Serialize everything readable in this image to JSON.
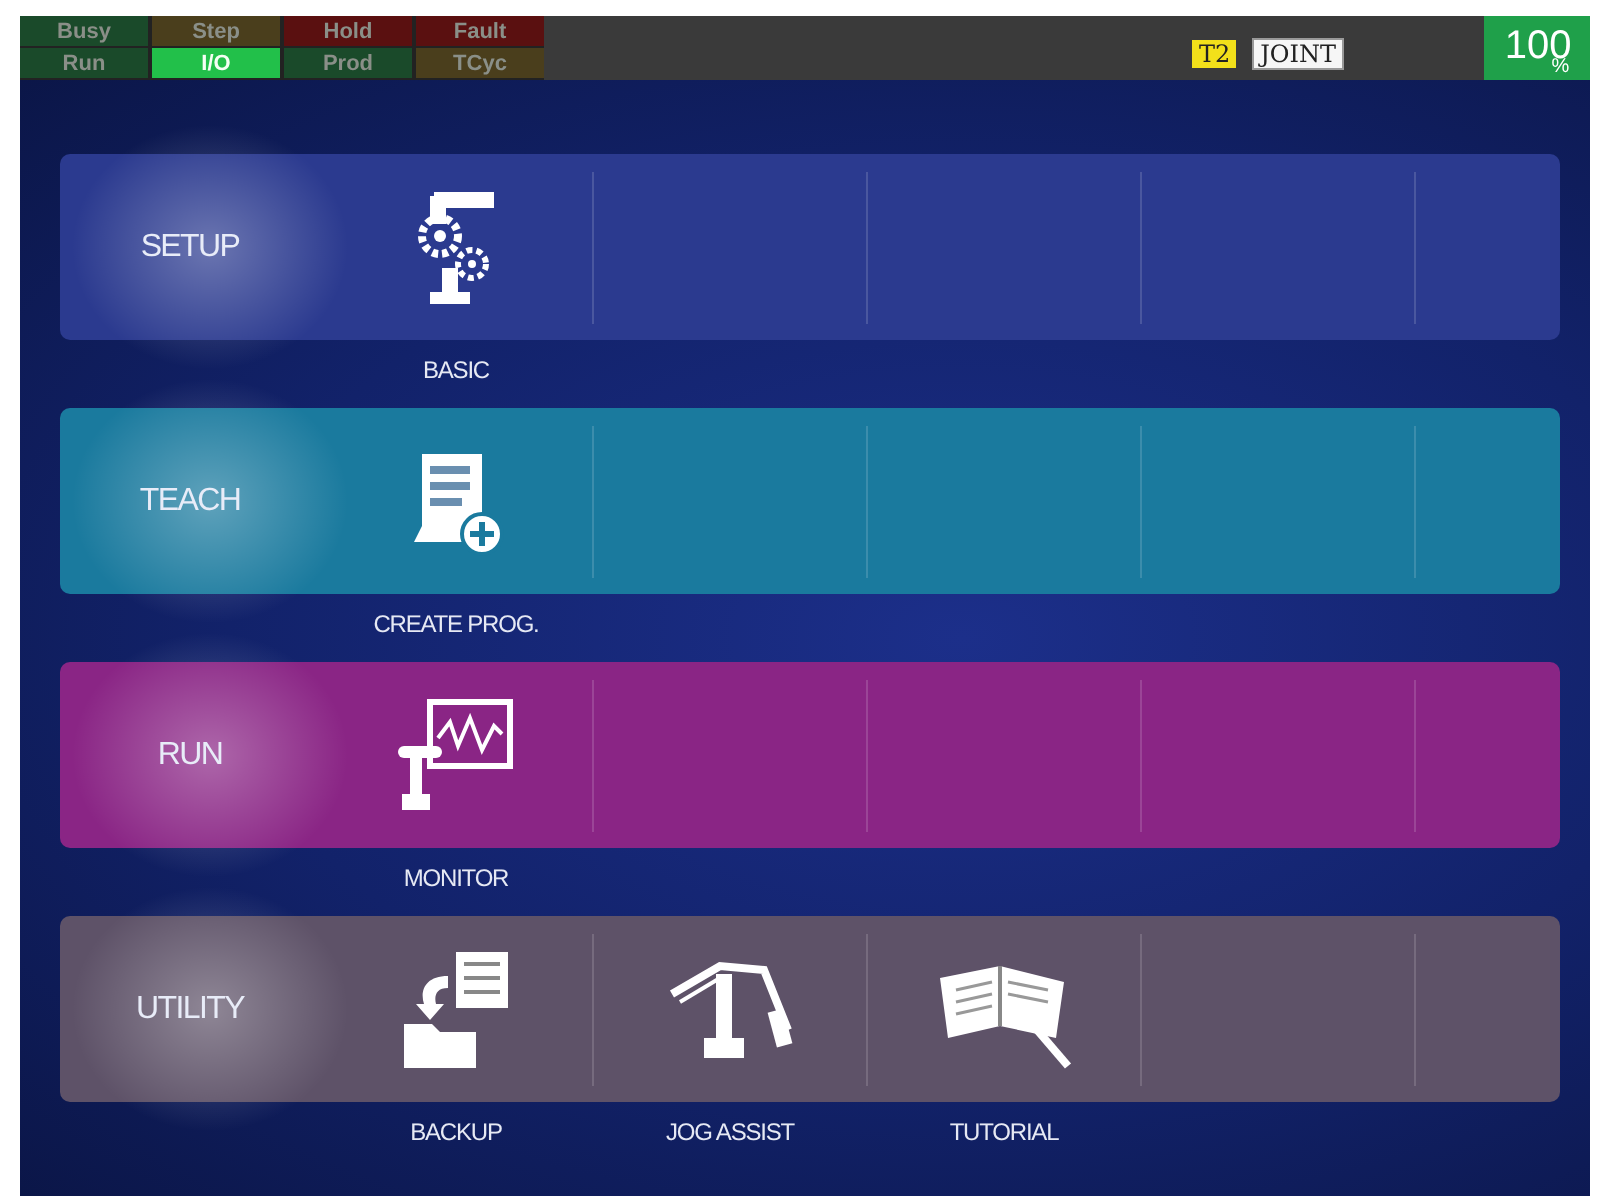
{
  "status_lamps": [
    {
      "label": "Busy",
      "on": false,
      "color": "#1a4a2a"
    },
    {
      "label": "Step",
      "on": false,
      "color": "#4a3e1c"
    },
    {
      "label": "Hold",
      "on": false,
      "color": "#5a1010"
    },
    {
      "label": "Fault",
      "on": false,
      "color": "#5a1010"
    },
    {
      "label": "Run",
      "on": false,
      "color": "#1a4a2a"
    },
    {
      "label": "I/O",
      "on": true,
      "color": "#22c04a"
    },
    {
      "label": "Prod",
      "on": false,
      "color": "#1a4a2a"
    },
    {
      "label": "TCyc",
      "on": false,
      "color": "#4a3e1c"
    }
  ],
  "mode_badges": [
    {
      "label": "T2",
      "kind": "tp"
    },
    {
      "label": "JOINT",
      "kind": "coord"
    }
  ],
  "override": {
    "value": "100",
    "unit": "%"
  },
  "categories": [
    {
      "label": "SETUP",
      "color": "#2b3a8f",
      "items": [
        {
          "label": "BASIC",
          "kind": "setup"
        }
      ]
    },
    {
      "label": "TEACH",
      "color": "#1a7a9e",
      "items": [
        {
          "label": "CREATE PROG.",
          "kind": "program"
        }
      ]
    },
    {
      "label": "RUN",
      "color": "#8a2585",
      "items": [
        {
          "label": "MONITOR",
          "kind": "monitor"
        }
      ]
    },
    {
      "label": "UTILITY",
      "color": "#5e5268",
      "items": [
        {
          "label": "BACKUP",
          "kind": "backup"
        },
        {
          "label": "JOG ASSIST",
          "kind": "jog"
        },
        {
          "label": "TUTORIAL",
          "kind": "tutorial"
        }
      ]
    }
  ]
}
